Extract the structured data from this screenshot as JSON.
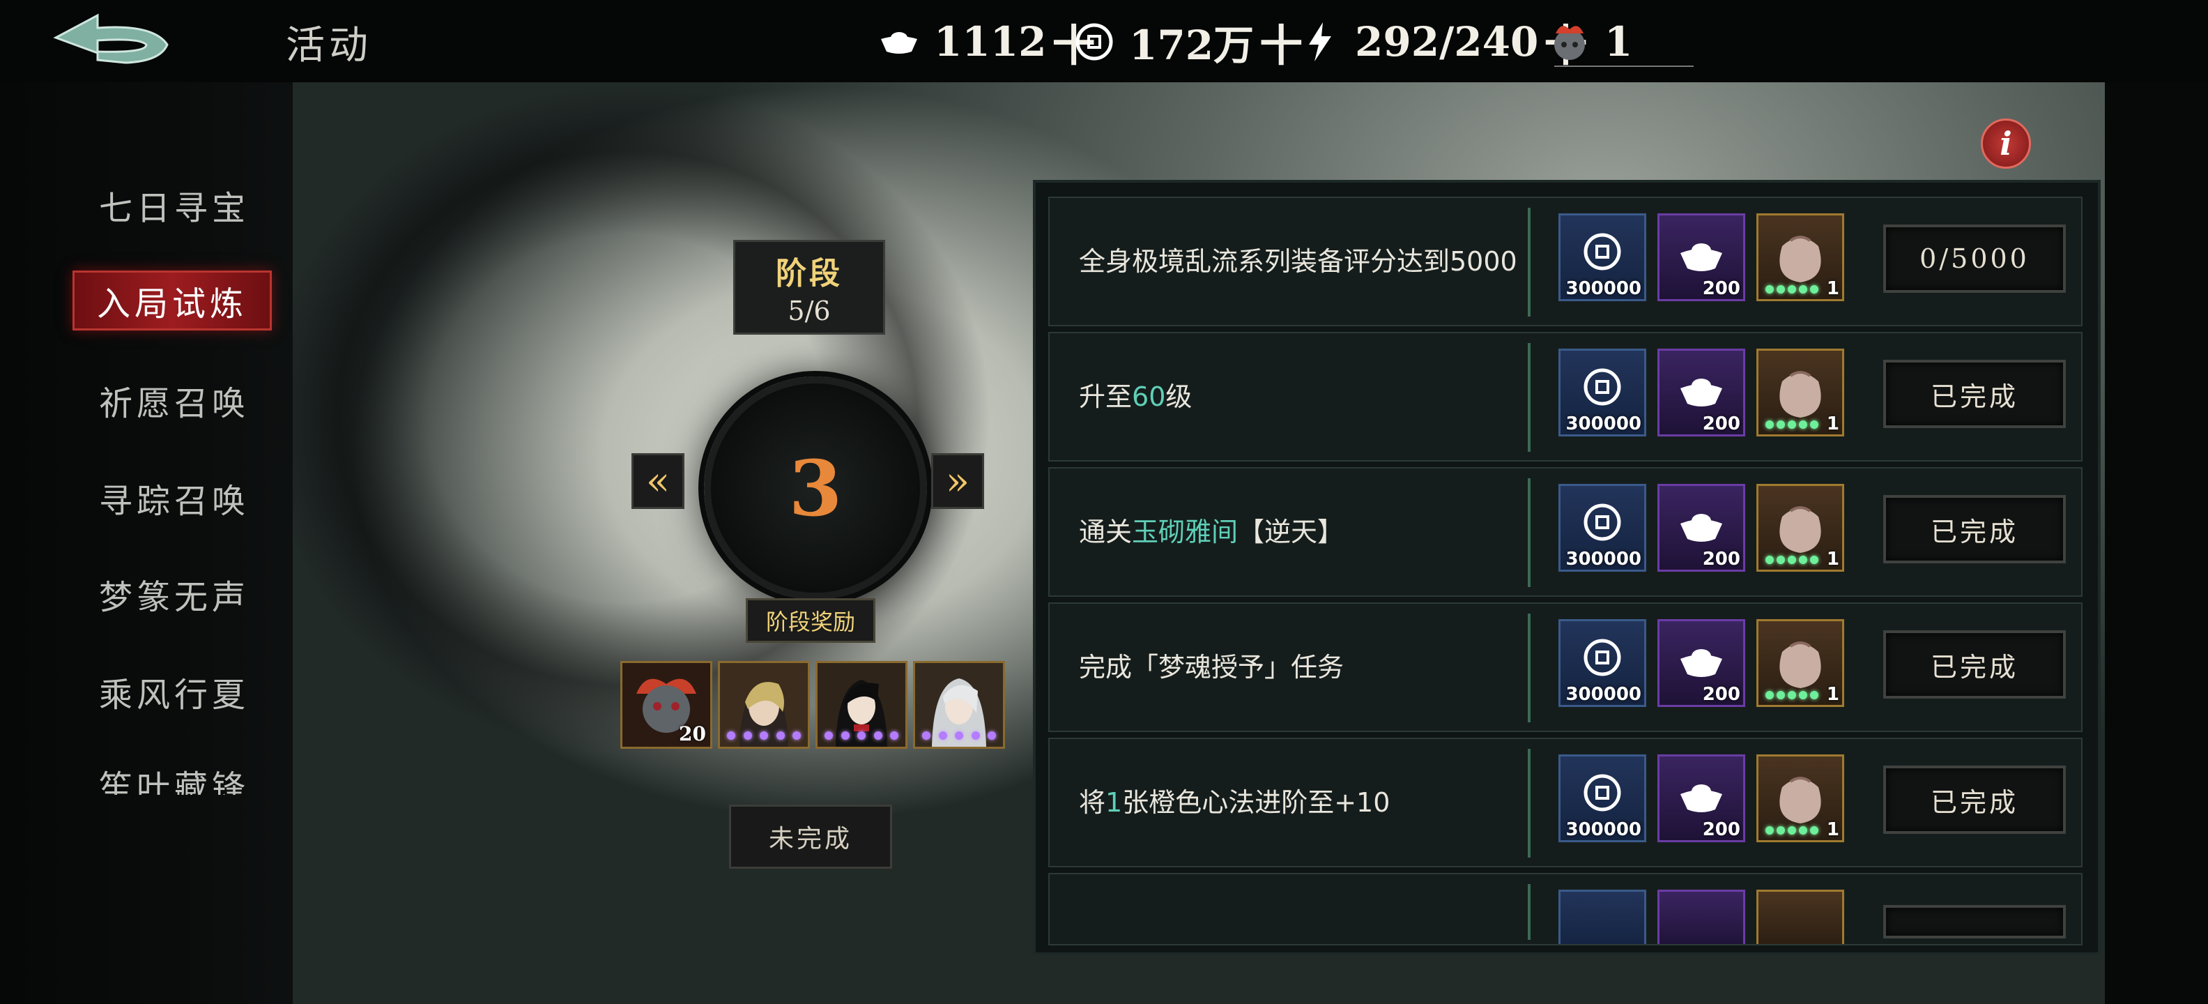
{
  "header": {
    "title": "活动",
    "resources": [
      {
        "icon": "silver-ingot-icon",
        "value": "1112",
        "plus": "十"
      },
      {
        "icon": "copper-coin-icon",
        "value": "172万",
        "plus": "十"
      },
      {
        "icon": "lightning-stamina-icon",
        "value": "292/240",
        "plus": "十"
      },
      {
        "icon": "demon-token-icon",
        "value": "1",
        "plus": ""
      }
    ]
  },
  "sidebar": {
    "items": [
      {
        "label": "七日寻宝",
        "active": false
      },
      {
        "label": "入局试炼",
        "active": true
      },
      {
        "label": "祈愿召唤",
        "active": false
      },
      {
        "label": "寻踪召唤",
        "active": false
      },
      {
        "label": "梦篆无声",
        "active": false
      },
      {
        "label": "乘风行夏",
        "active": false
      },
      {
        "label": "笙叶藏锋",
        "active": false
      }
    ]
  },
  "stage": {
    "label": "阶段",
    "progress": "5/6",
    "number": "3",
    "prev_arrow": "«",
    "next_arrow": "»",
    "reward_label": "阶段奖励",
    "rewards": [
      {
        "icon": "demon-mask-token-icon",
        "count": "20"
      },
      {
        "icon": "hero-portrait-icon",
        "count": ""
      },
      {
        "icon": "hero-portrait-icon",
        "count": ""
      },
      {
        "icon": "hero-portrait-icon",
        "count": ""
      }
    ],
    "status_button": "未完成"
  },
  "info_button": "i",
  "tasks": [
    {
      "desc_parts": [
        {
          "text": "全身极境乱流系列装备评分达到5000",
          "hl": false
        }
      ],
      "rewards": [
        "300000",
        "200",
        "1"
      ],
      "action": "0/5000"
    },
    {
      "desc_parts": [
        {
          "text": "升至",
          "hl": false
        },
        {
          "text": "60",
          "hl": true
        },
        {
          "text": "级",
          "hl": false
        }
      ],
      "rewards": [
        "300000",
        "200",
        "1"
      ],
      "action": "已完成"
    },
    {
      "desc_parts": [
        {
          "text": "通关",
          "hl": false
        },
        {
          "text": "玉砌雅间",
          "hl": true
        },
        {
          "text": "【逆天】",
          "hl": false
        }
      ],
      "rewards": [
        "300000",
        "200",
        "1"
      ],
      "action": "已完成"
    },
    {
      "desc_parts": [
        {
          "text": "完成「梦魂授予」任务",
          "hl": false
        }
      ],
      "rewards": [
        "300000",
        "200",
        "1"
      ],
      "action": "已完成"
    },
    {
      "desc_parts": [
        {
          "text": "将",
          "hl": false
        },
        {
          "text": "1",
          "hl": true
        },
        {
          "text": "张橙色心法进阶至+10",
          "hl": false
        }
      ],
      "rewards": [
        "300000",
        "200",
        "1"
      ],
      "action": "已完成"
    }
  ],
  "colors": {
    "accent_red": "#9d1c1f",
    "highlight_teal": "#5fd0b8",
    "stage_number_orange": "#e8883a",
    "gold_text": "#f0d27a"
  }
}
